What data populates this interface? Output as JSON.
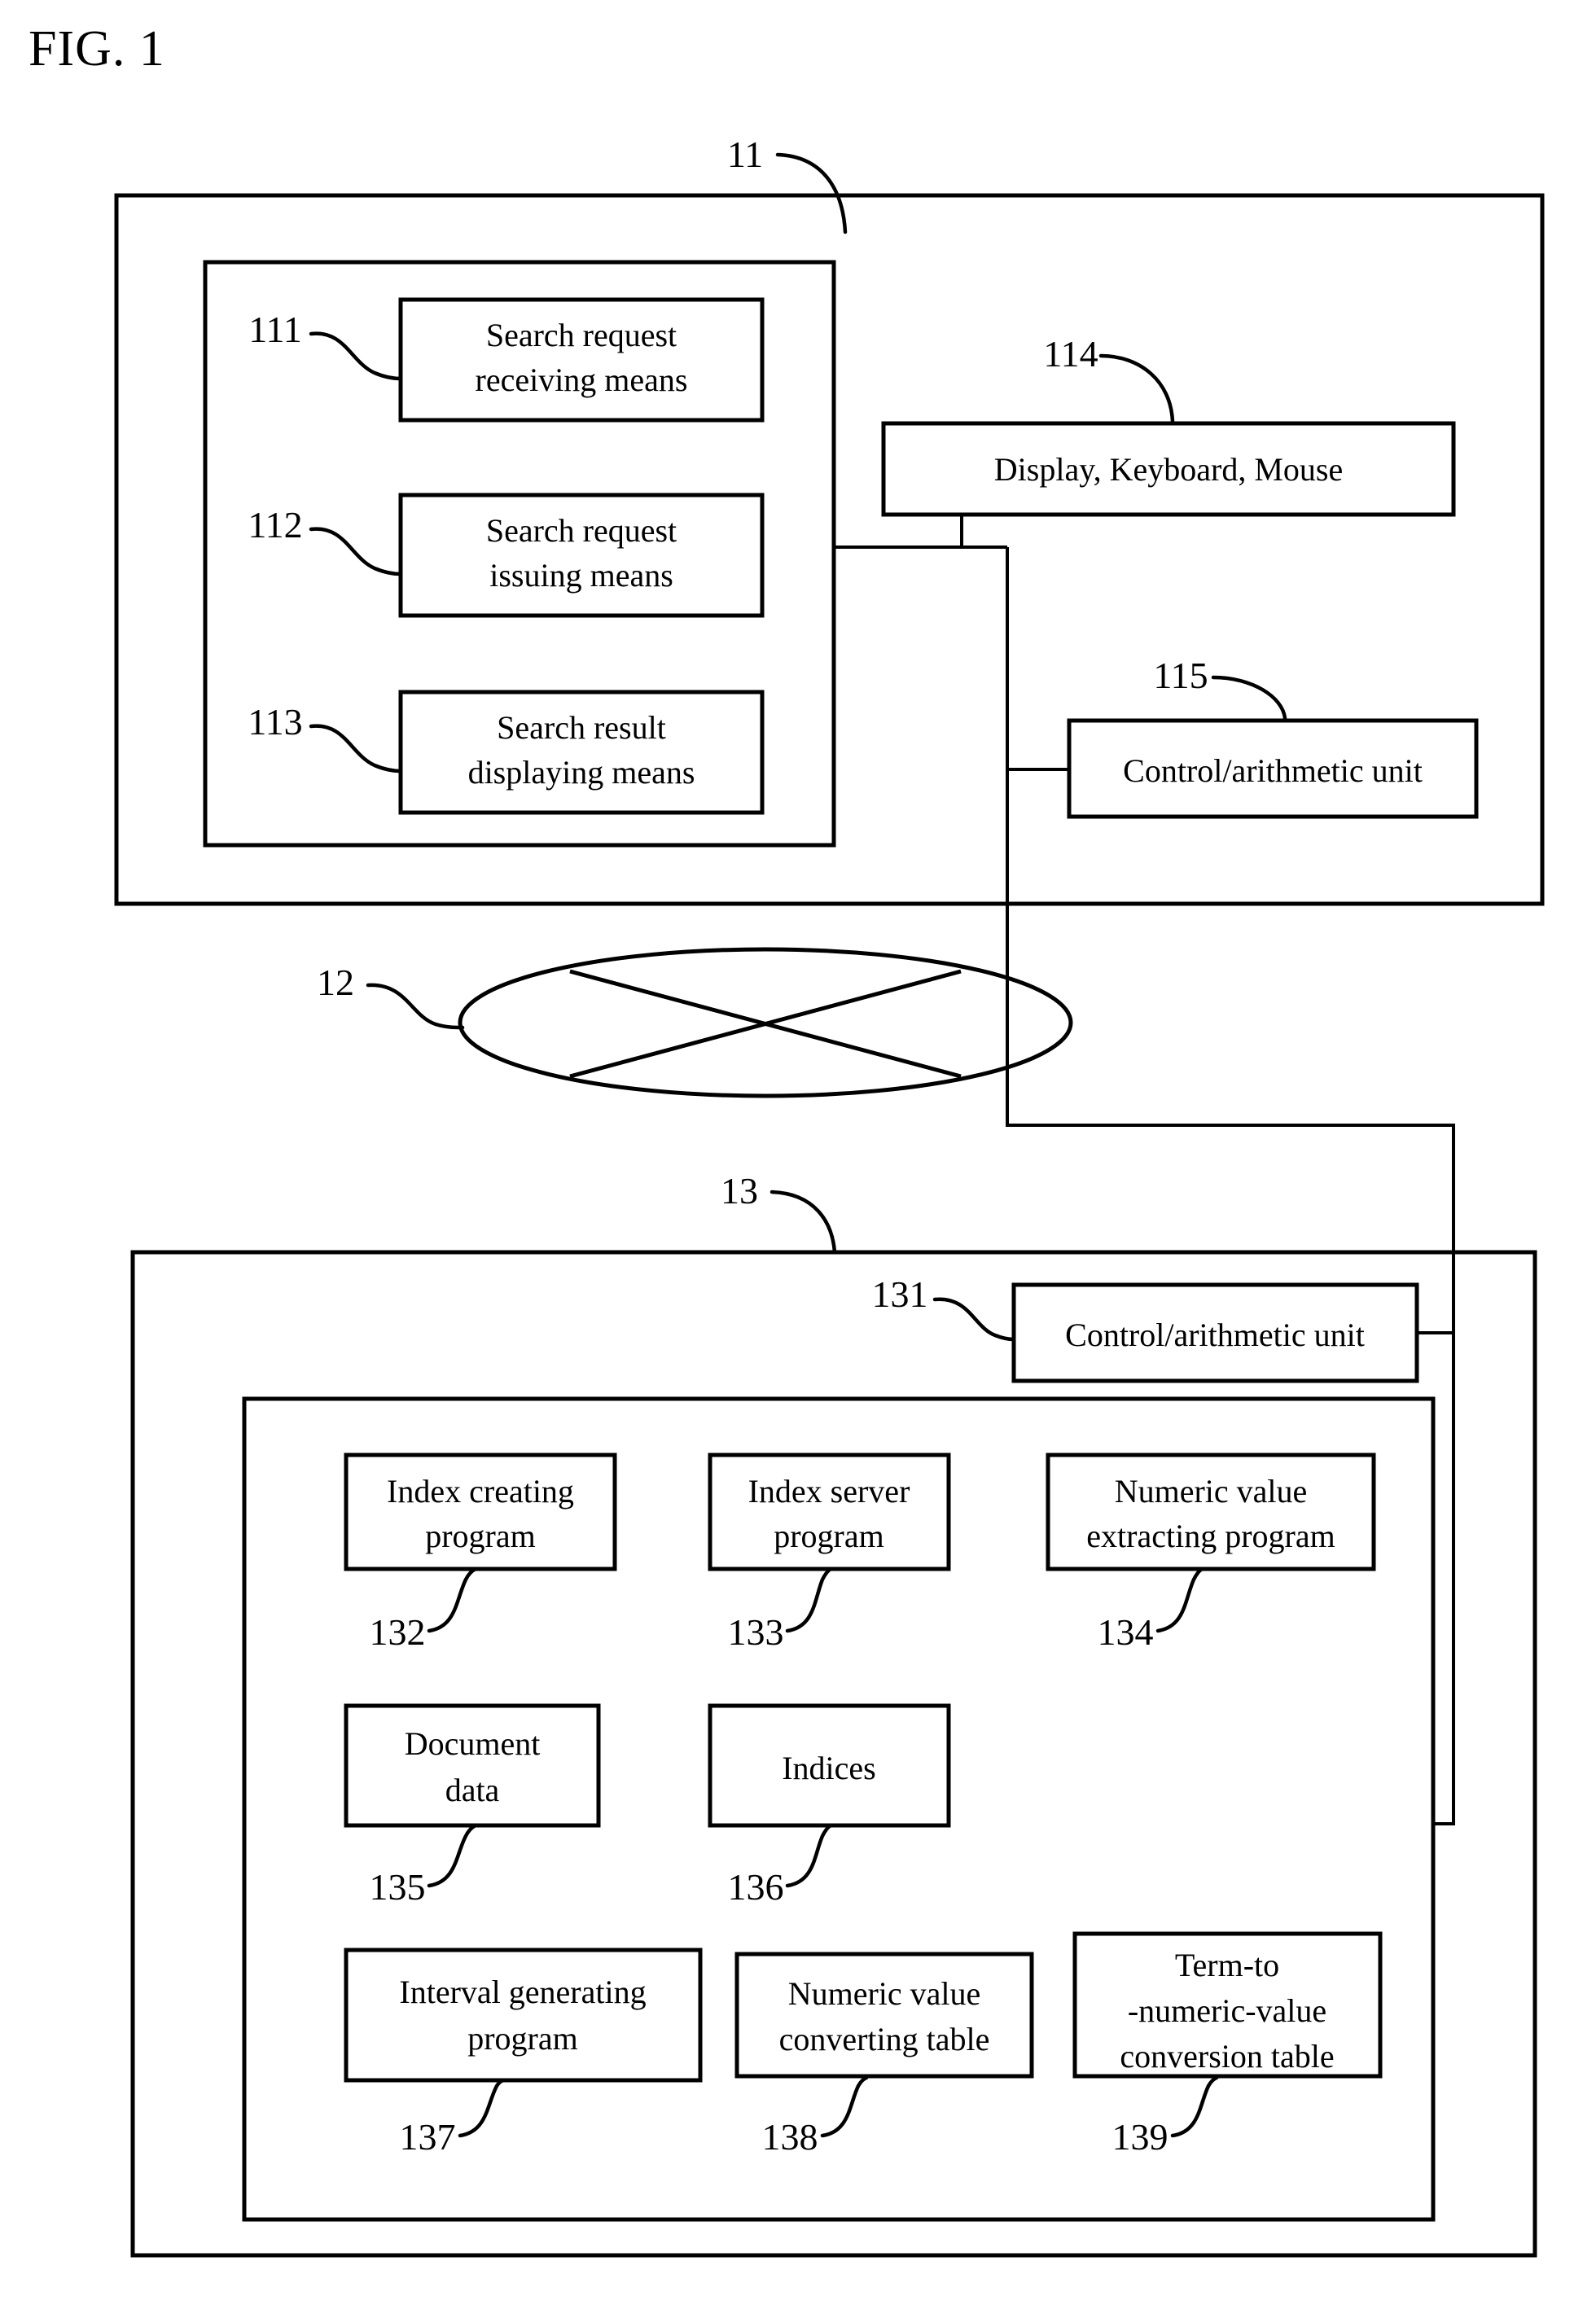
{
  "figure": {
    "title": "FIG. 1",
    "type": "patent-block-diagram"
  },
  "client": {
    "ref": "11",
    "inner_group_ref": "",
    "modules": [
      {
        "ref": "111",
        "label_line1": "Search request",
        "label_line2": "receiving means"
      },
      {
        "ref": "112",
        "label_line1": "Search request",
        "label_line2": "issuing means"
      },
      {
        "ref": "113",
        "label_line1": "Search result",
        "label_line2": "displaying means"
      }
    ],
    "peripherals": {
      "ref": "114",
      "label": "Display, Keyboard, Mouse"
    },
    "cpu": {
      "ref": "115",
      "label": "Control/arithmetic unit"
    }
  },
  "network": {
    "ref": "12",
    "icon": "network-cloud-icon"
  },
  "server": {
    "ref": "13",
    "cpu": {
      "ref": "131",
      "label": "Control/arithmetic unit"
    },
    "components": [
      {
        "ref": "132",
        "label_line1": "Index creating",
        "label_line2": "program"
      },
      {
        "ref": "133",
        "label_line1": "Index server",
        "label_line2": "program"
      },
      {
        "ref": "134",
        "label_line1": "Numeric value",
        "label_line2": "extracting program"
      },
      {
        "ref": "135",
        "label_line1": "Document",
        "label_line2": "data"
      },
      {
        "ref": "136",
        "label_line1": "Indices",
        "label_line2": ""
      },
      {
        "ref": "137",
        "label_line1": "Interval generating",
        "label_line2": "program"
      },
      {
        "ref": "138",
        "label_line1": "Numeric value",
        "label_line2": "converting table"
      },
      {
        "ref": "139",
        "label_line1": "Term-to",
        "label_line2": "-numeric-value",
        "label_line3": "conversion table"
      }
    ]
  },
  "colors": {
    "stroke": "#000000",
    "background": "#ffffff"
  }
}
